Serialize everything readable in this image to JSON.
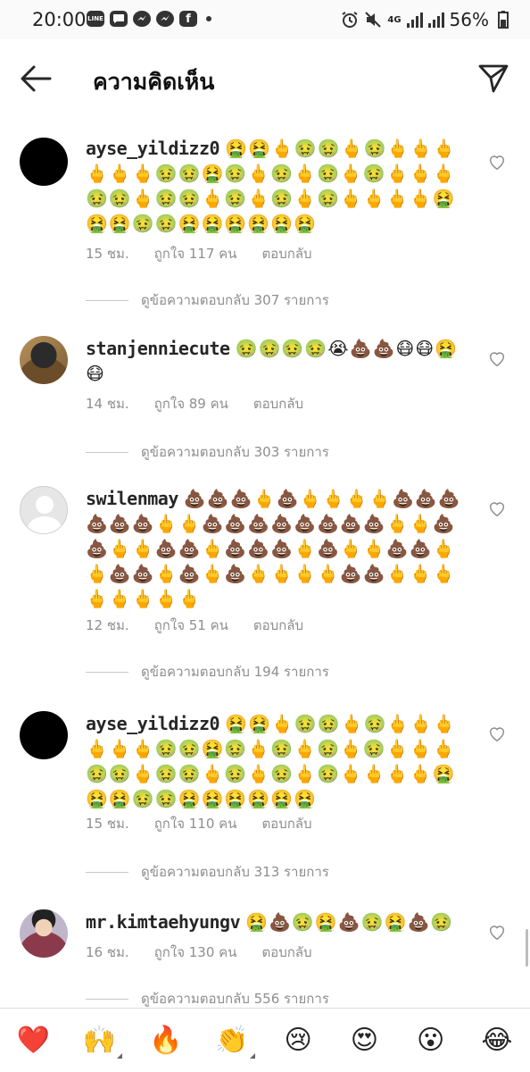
{
  "status_bar": {
    "time": "20:00",
    "apps": [
      "LINE",
      "Messages",
      "Messenger",
      "Messenger",
      "Facebook"
    ],
    "network": "4G",
    "battery": "56%"
  },
  "header": {
    "title": "ความคิดเห็น"
  },
  "comments": [
    {
      "username": "ayse_yildizz0",
      "text": "🤮🤮🖕🤢🤢🖕🤢🖕🖕🖕🖕🖕🖕🤢🤢🤮🤢🖕🤢🖕🤢🖕🤢🖕🖕🖕🤢🤢🖕🤢🤢🖕🤢🖕🤢🖕🤢🖕🖕🖕🖕🤮🤮🤮🤢🤢🤮🤮🤮🤮🤮🤮",
      "time": "15 ชม.",
      "likes": "ถูกใจ 117 คน",
      "reply": "ตอบกลับ",
      "view_replies": "ดูข้อความตอบกลับ 307 รายการ"
    },
    {
      "username": "stanjenniecute",
      "text": "🤢🤢🤢🤢😭💩💩😷😷🤮😷",
      "time": "14 ชม.",
      "likes": "ถูกใจ 89 คน",
      "reply": "ตอบกลับ",
      "view_replies": "ดูข้อความตอบกลับ 303 รายการ"
    },
    {
      "username": "swilenmay",
      "text": "💩💩💩🖕💩🖕🖕🖕🖕💩💩💩💩💩💩🖕🖕💩💩💩💩💩💩💩💩🖕🖕💩💩🖕🖕💩💩🖕💩💩💩🖕💩🖕🖕💩💩🖕🖕💩💩🖕💩🖕💩🖕🖕🖕🖕💩💩🖕🖕🖕🖕🖕🖕🖕🖕",
      "time": "12 ชม.",
      "likes": "ถูกใจ 51 คน",
      "reply": "ตอบกลับ",
      "view_replies": "ดูข้อความตอบกลับ 194 รายการ"
    },
    {
      "username": "ayse_yildizz0",
      "text": "🤮🤮🖕🤢🤢🖕🤢🖕🖕🖕🖕🖕🖕🤢🤢🤮🤢🖕🤢🖕🤢🖕🤢🖕🖕🖕🤢🤢🖕🤢🤢🖕🤢🖕🤢🖕🤢🖕🖕🖕🖕🤮🤮🤮🤢🤢🤮🤮🤮🤮🤮🤮",
      "time": "15 ชม.",
      "likes": "ถูกใจ 110 คน",
      "reply": "ตอบกลับ",
      "view_replies": "ดูข้อความตอบกลับ 313 รายการ"
    },
    {
      "username": "mr.kimtaehyungv",
      "text": "🤮💩🤢🤮💩🤢🤮💩🤢",
      "time": "16 ชม.",
      "likes": "ถูกใจ 130 คน",
      "reply": "ตอบกลับ",
      "view_replies": "ดูข้อความตอบกลับ 556 รายการ"
    }
  ],
  "quick_emojis": [
    "❤️",
    "🙌",
    "🔥",
    "👏",
    "😢",
    "😍",
    "😮",
    "😂"
  ]
}
